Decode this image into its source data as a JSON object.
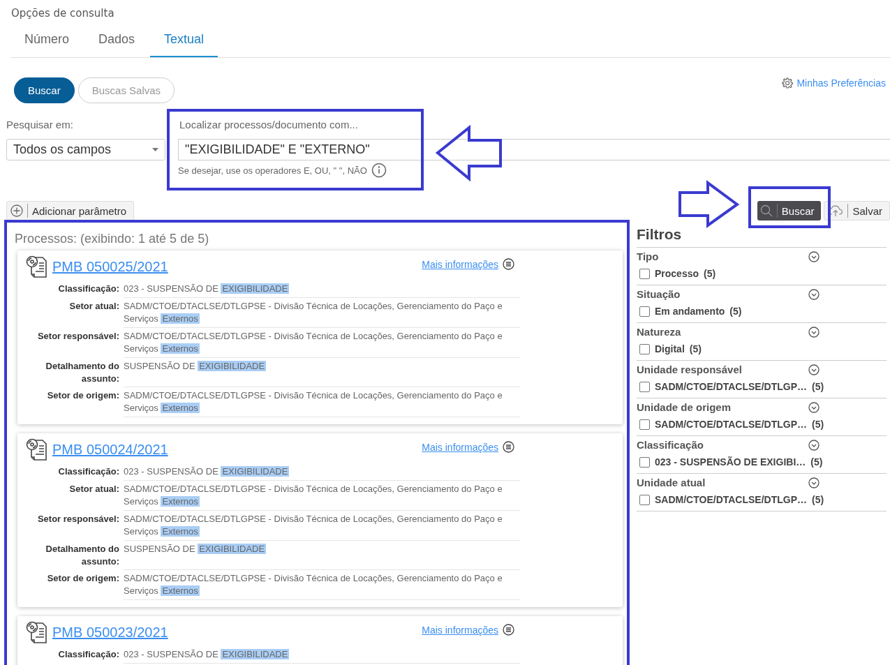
{
  "header": {
    "title": "Opções de consulta"
  },
  "tabs": [
    {
      "label": "Número",
      "selected": false
    },
    {
      "label": "Dados",
      "selected": false
    },
    {
      "label": "Textual",
      "selected": true
    }
  ],
  "toolbar": {
    "buttons": [
      {
        "label": "Buscar",
        "selected": true
      },
      {
        "label": "Buscas Salvas",
        "selected": false
      }
    ],
    "preferences_link": "Minhas Preferências"
  },
  "search": {
    "scope_label": "Pesquisar em:",
    "scope_value": "Todos os campos",
    "query_label": "Localizar processos/documento com...",
    "query_value": "\"EXIGIBILIDADE\" E \"EXTERNO\"",
    "hint": "Se desejar, use os operadores E, OU, \" \", NÃO"
  },
  "actions": {
    "add_parameter": "Adicionar parâmetro",
    "search_button": "Buscar",
    "save_button": "Salvar"
  },
  "results": {
    "summary": "Processos: (exibindo: 1 até 5 de 5)",
    "items": [
      {
        "title": "PMB 050025/2021",
        "more_link": "Mais informações",
        "fields": [
          {
            "label": "Classificação:",
            "text": "023 - SUSPENSÃO DE ",
            "highlight": "EXIGIBILIDADE"
          },
          {
            "label": "Setor atual:",
            "text": "SADM/CTOE/DTACLSE/DTLGPSE - Divisão Técnica de Locações, Gerenciamento do Paço e Serviços ",
            "highlight": "Externos"
          },
          {
            "label": "Setor responsável:",
            "text": "SADM/CTOE/DTACLSE/DTLGPSE - Divisão Técnica de Locações, Gerenciamento do Paço e Serviços ",
            "highlight": "Externos"
          },
          {
            "label": "Detalhamento do assunto:",
            "text": "SUSPENSÃO DE ",
            "highlight": "EXIGIBILIDADE"
          },
          {
            "label": "Setor de origem:",
            "text": "SADM/CTOE/DTACLSE/DTLGPSE - Divisão Técnica de Locações, Gerenciamento do Paço e Serviços ",
            "highlight": "Externos"
          }
        ]
      },
      {
        "title": "PMB 050024/2021",
        "more_link": "Mais informações",
        "fields": [
          {
            "label": "Classificação:",
            "text": "023 - SUSPENSÃO DE ",
            "highlight": "EXIGIBILIDADE"
          },
          {
            "label": "Setor atual:",
            "text": "SADM/CTOE/DTACLSE/DTLGPSE - Divisão Técnica de Locações, Gerenciamento do Paço e Serviços ",
            "highlight": "Externos"
          },
          {
            "label": "Setor responsável:",
            "text": "SADM/CTOE/DTACLSE/DTLGPSE - Divisão Técnica de Locações, Gerenciamento do Paço e Serviços ",
            "highlight": "Externos"
          },
          {
            "label": "Detalhamento do assunto:",
            "text": "SUSPENSÃO DE ",
            "highlight": "EXIGIBILIDADE"
          },
          {
            "label": "Setor de origem:",
            "text": "SADM/CTOE/DTACLSE/DTLGPSE - Divisão Técnica de Locações, Gerenciamento do Paço e Serviços ",
            "highlight": "Externos"
          }
        ]
      },
      {
        "title": "PMB 050023/2021",
        "more_link": "Mais informações",
        "fields": [
          {
            "label": "Classificação:",
            "text": "023 - SUSPENSÃO DE ",
            "highlight": "EXIGIBILIDADE"
          }
        ]
      }
    ]
  },
  "filters": {
    "title": "Filtros",
    "groups": [
      {
        "title": "Tipo",
        "options": [
          {
            "label": "Processo",
            "count": "(5)",
            "checked": false
          }
        ]
      },
      {
        "title": "Situação",
        "options": [
          {
            "label": "Em andamento",
            "count": "(5)",
            "checked": false
          }
        ]
      },
      {
        "title": "Natureza",
        "options": [
          {
            "label": "Digital",
            "count": "(5)",
            "checked": false
          }
        ]
      },
      {
        "title": "Unidade responsável",
        "options": [
          {
            "label": "SADM/CTOE/DTACLSE/DTLGP…",
            "count": "(5)",
            "checked": false
          }
        ]
      },
      {
        "title": "Unidade de origem",
        "options": [
          {
            "label": "SADM/CTOE/DTACLSE/DTLGP…",
            "count": "(5)",
            "checked": false
          }
        ]
      },
      {
        "title": "Classificação",
        "options": [
          {
            "label": "023 - SUSPENSÃO DE EXIGIBI…",
            "count": "(5)",
            "checked": false
          }
        ]
      },
      {
        "title": "Unidade atual",
        "options": [
          {
            "label": "SADM/CTOE/DTACLSE/DTLGP…",
            "count": "(5)",
            "checked": false
          }
        ]
      }
    ]
  }
}
